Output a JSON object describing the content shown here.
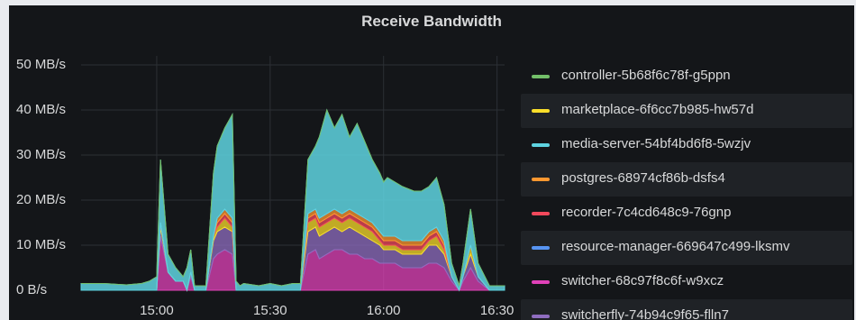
{
  "panel": {
    "title": "Receive Bandwidth"
  },
  "legend": [
    {
      "label": "controller-5b68f6c78f-g5ppn",
      "color": "#73bf69"
    },
    {
      "label": "marketplace-6f6cc7b985-hw57d",
      "color": "#fade2a"
    },
    {
      "label": "media-server-54bf4bd6f8-5wzjv",
      "color": "#5ed3e0"
    },
    {
      "label": "postgres-68974cf86b-dsfs4",
      "color": "#ff9830"
    },
    {
      "label": "recorder-7c4cd648c9-76gnp",
      "color": "#f2495c"
    },
    {
      "label": "resource-manager-669647c499-lksmv",
      "color": "#5794f2"
    },
    {
      "label": "switcher-68c97f8c6f-w9xcz",
      "color": "#e041b8"
    },
    {
      "label": "switcherfly-74b94c9f65-flln7",
      "color": "#8f6dc0"
    }
  ],
  "chart_data": {
    "type": "area",
    "title": "Receive Bandwidth",
    "stacked": true,
    "grid": true,
    "legend_position": "right",
    "y_unit": "MB/s",
    "yticks": [
      "50 MB/s",
      "40 MB/s",
      "30 MB/s",
      "20 MB/s",
      "10 MB/s",
      "0 B/s"
    ],
    "ylim": [
      0,
      50
    ],
    "xticks": [
      "15:00",
      "15:30",
      "16:00",
      "16:30"
    ],
    "x_minutes": [
      -20,
      -14,
      -8,
      -4,
      -2,
      0,
      1,
      3,
      5,
      7,
      8,
      9,
      10,
      13,
      15,
      16,
      18,
      20,
      21,
      22,
      23,
      27,
      30,
      33,
      36,
      38,
      40,
      42,
      43,
      45,
      47,
      49,
      51,
      53,
      55,
      57,
      59,
      60,
      61,
      63,
      65,
      68,
      70,
      72,
      74,
      76,
      78,
      80,
      81,
      83,
      85,
      88,
      92
    ],
    "series": [
      {
        "name": "switcher-68c97f8c6f-w9xcz",
        "values": [
          0,
          0,
          0,
          0,
          0,
          0,
          12,
          4,
          2,
          2,
          0,
          3,
          0,
          0,
          7,
          8,
          9,
          8,
          0,
          0,
          0,
          0,
          0,
          0,
          0,
          0,
          8,
          9,
          7,
          8,
          9,
          9,
          8,
          8,
          7,
          7,
          6,
          6,
          6,
          6,
          5,
          5,
          5,
          6,
          6,
          5,
          2,
          0,
          2,
          5,
          2,
          0,
          0
        ]
      },
      {
        "name": "switcherfly-74b94c9f65-flln7",
        "values": [
          0,
          0,
          0,
          0,
          0,
          0,
          2,
          0,
          0,
          0,
          0,
          1,
          0,
          0,
          4,
          5,
          5,
          5,
          0,
          0,
          0,
          0,
          0,
          0,
          0,
          0,
          5,
          5,
          5,
          5,
          5,
          4,
          6,
          5,
          5,
          4,
          4,
          3,
          3,
          3,
          3,
          3,
          3,
          4,
          4,
          3,
          1,
          0,
          1,
          3,
          1,
          0,
          0
        ]
      },
      {
        "name": "marketplace-6f6cc7b985-hw57d",
        "values": [
          0,
          0,
          0,
          0,
          0,
          0,
          1,
          0,
          0,
          0,
          0,
          0,
          0,
          0,
          1,
          1,
          2,
          1,
          0,
          0,
          0,
          0,
          0,
          0,
          0,
          0,
          2,
          2,
          2,
          2,
          2,
          2,
          2,
          2,
          2,
          2,
          1,
          1,
          1,
          1,
          1,
          1,
          1,
          1,
          2,
          1,
          0,
          0,
          0,
          2,
          0,
          0,
          0
        ]
      },
      {
        "name": "recorder-7c4cd648c9-76gnp",
        "values": [
          0,
          0,
          0,
          0,
          0,
          0,
          0,
          0,
          0,
          0,
          0,
          0,
          0,
          0,
          0,
          1,
          1,
          1,
          0,
          0,
          0,
          0,
          0,
          0,
          0,
          0,
          1,
          1,
          1,
          1,
          1,
          1,
          1,
          1,
          1,
          1,
          1,
          1,
          1,
          1,
          1,
          1,
          1,
          1,
          1,
          1,
          0,
          0,
          0,
          0,
          0,
          0,
          0
        ]
      },
      {
        "name": "postgres-68974cf86b-dsfs4",
        "values": [
          0,
          0,
          0,
          0,
          0,
          0,
          0,
          0,
          0,
          0,
          0,
          0,
          0,
          0,
          0,
          1,
          1,
          1,
          0,
          0,
          0,
          0,
          0,
          0,
          0,
          0,
          1,
          1,
          1,
          1,
          1,
          1,
          1,
          1,
          1,
          1,
          1,
          1,
          1,
          1,
          1,
          1,
          1,
          1,
          1,
          1,
          0,
          0,
          0,
          0,
          0,
          0,
          0
        ]
      },
      {
        "name": "resource-manager-669647c499-lksmv",
        "values": [
          0,
          0,
          0,
          0,
          0,
          0,
          0,
          0,
          0,
          0,
          0,
          0,
          0,
          0,
          0,
          0,
          0,
          0,
          0,
          0,
          0,
          0,
          0,
          0,
          0,
          0,
          0,
          0,
          0,
          0,
          0,
          0,
          0,
          0,
          0,
          0,
          0,
          0,
          0,
          0,
          0,
          0,
          0,
          0,
          0,
          0,
          0,
          0,
          0,
          0,
          0,
          0,
          0
        ]
      },
      {
        "name": "media-server-54bf4bd6f8-5wzjv",
        "values": [
          1.5,
          1.5,
          1.2,
          1.5,
          2,
          3,
          14,
          4,
          3,
          1,
          5,
          5,
          1,
          1,
          14,
          16,
          18,
          23,
          2,
          1,
          1.5,
          1,
          1.5,
          1,
          1.5,
          1.5,
          12,
          14,
          18,
          23,
          18,
          22,
          16,
          20,
          17,
          14,
          13,
          12,
          13,
          12,
          12,
          11,
          11,
          10,
          11,
          8,
          3,
          1,
          3,
          8,
          3,
          1,
          1
        ]
      },
      {
        "name": "controller-5b68f6c78f-g5ppn",
        "values": [
          0,
          0,
          0,
          0,
          0,
          0,
          0,
          0,
          0,
          0,
          0,
          0,
          0,
          0,
          0,
          0,
          0,
          0,
          0,
          0,
          0,
          0,
          0,
          0,
          0,
          0,
          0,
          0,
          0,
          0,
          0,
          0,
          0,
          0,
          0,
          0,
          0,
          0,
          0,
          0,
          0,
          0,
          0,
          0,
          0,
          0,
          0,
          0,
          0,
          0,
          0,
          0,
          0
        ]
      }
    ]
  }
}
